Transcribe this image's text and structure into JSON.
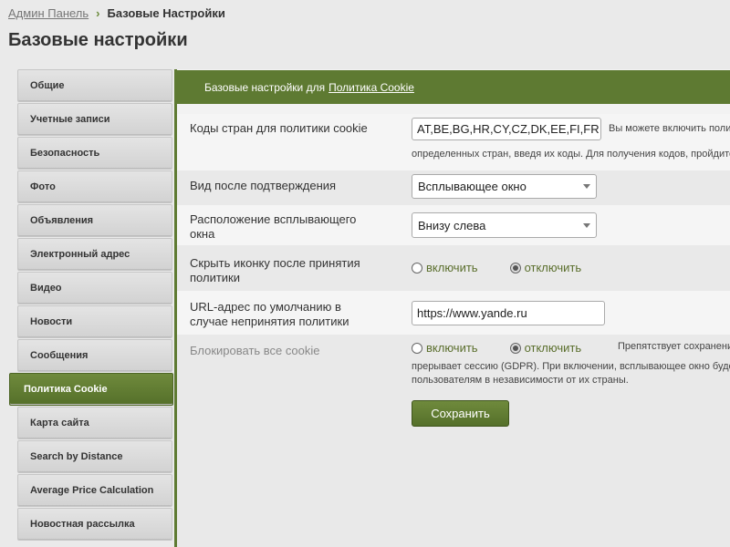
{
  "breadcrumb": {
    "root": "Админ Панель",
    "separator": "›",
    "current": "Базовые Настройки"
  },
  "page_title": "Базовые настройки",
  "sidebar": {
    "items": [
      {
        "label": "Общие"
      },
      {
        "label": "Учетные записи"
      },
      {
        "label": "Безопасность"
      },
      {
        "label": "Фото"
      },
      {
        "label": "Объявления"
      },
      {
        "label": "Электронный адрес"
      },
      {
        "label": "Видео"
      },
      {
        "label": "Новости"
      },
      {
        "label": "Сообщения"
      },
      {
        "label": "Политика Cookie",
        "active": true
      },
      {
        "label": "Карта сайта"
      },
      {
        "label": "Search by Distance"
      },
      {
        "label": "Average Price Calculation"
      },
      {
        "label": "Новостная рассылка"
      }
    ]
  },
  "panel": {
    "header_prefix": "Базовые настройки для",
    "header_link": "Политика Cookie",
    "country_codes": {
      "label": "Коды стран для политики cookie",
      "value": "AT,BE,BG,HR,CY,CZ,DK,EE,FI,FR",
      "note_line1": "Вы можете включить полит",
      "note_line2": "определенных стран, введя их коды. Для получения кодов, пройдите"
    },
    "view_after": {
      "label": "Вид после подтверждения",
      "value": "Всплывающее окно"
    },
    "popup_position": {
      "label_line1": "Расположение всплывающего",
      "label_line2": "окна",
      "value": "Внизу слева"
    },
    "hide_icon": {
      "label_line1": "Скрыть иконку после принятия",
      "label_line2": "политики",
      "on_label": "включить",
      "off_label": "отключить",
      "selected": "off"
    },
    "default_url": {
      "label_line1": "URL-адрес по умолчанию в",
      "label_line2": "случае непринятия политики",
      "value": "https://www.yande.ru"
    },
    "block_cookies": {
      "label": "Блокировать все cookie",
      "on_label": "включить",
      "off_label": "отключить",
      "selected": "off",
      "note_line1": "Препятствует сохранени",
      "note_line2": "прерывает сессию (GDPR). При включении, всплывающее окно буде",
      "note_line3": "пользователям в независимости от их страны."
    },
    "save_label": "Сохранить"
  },
  "colors": {
    "accent": "#5e7a32",
    "page_bg": "#eaeaea"
  }
}
